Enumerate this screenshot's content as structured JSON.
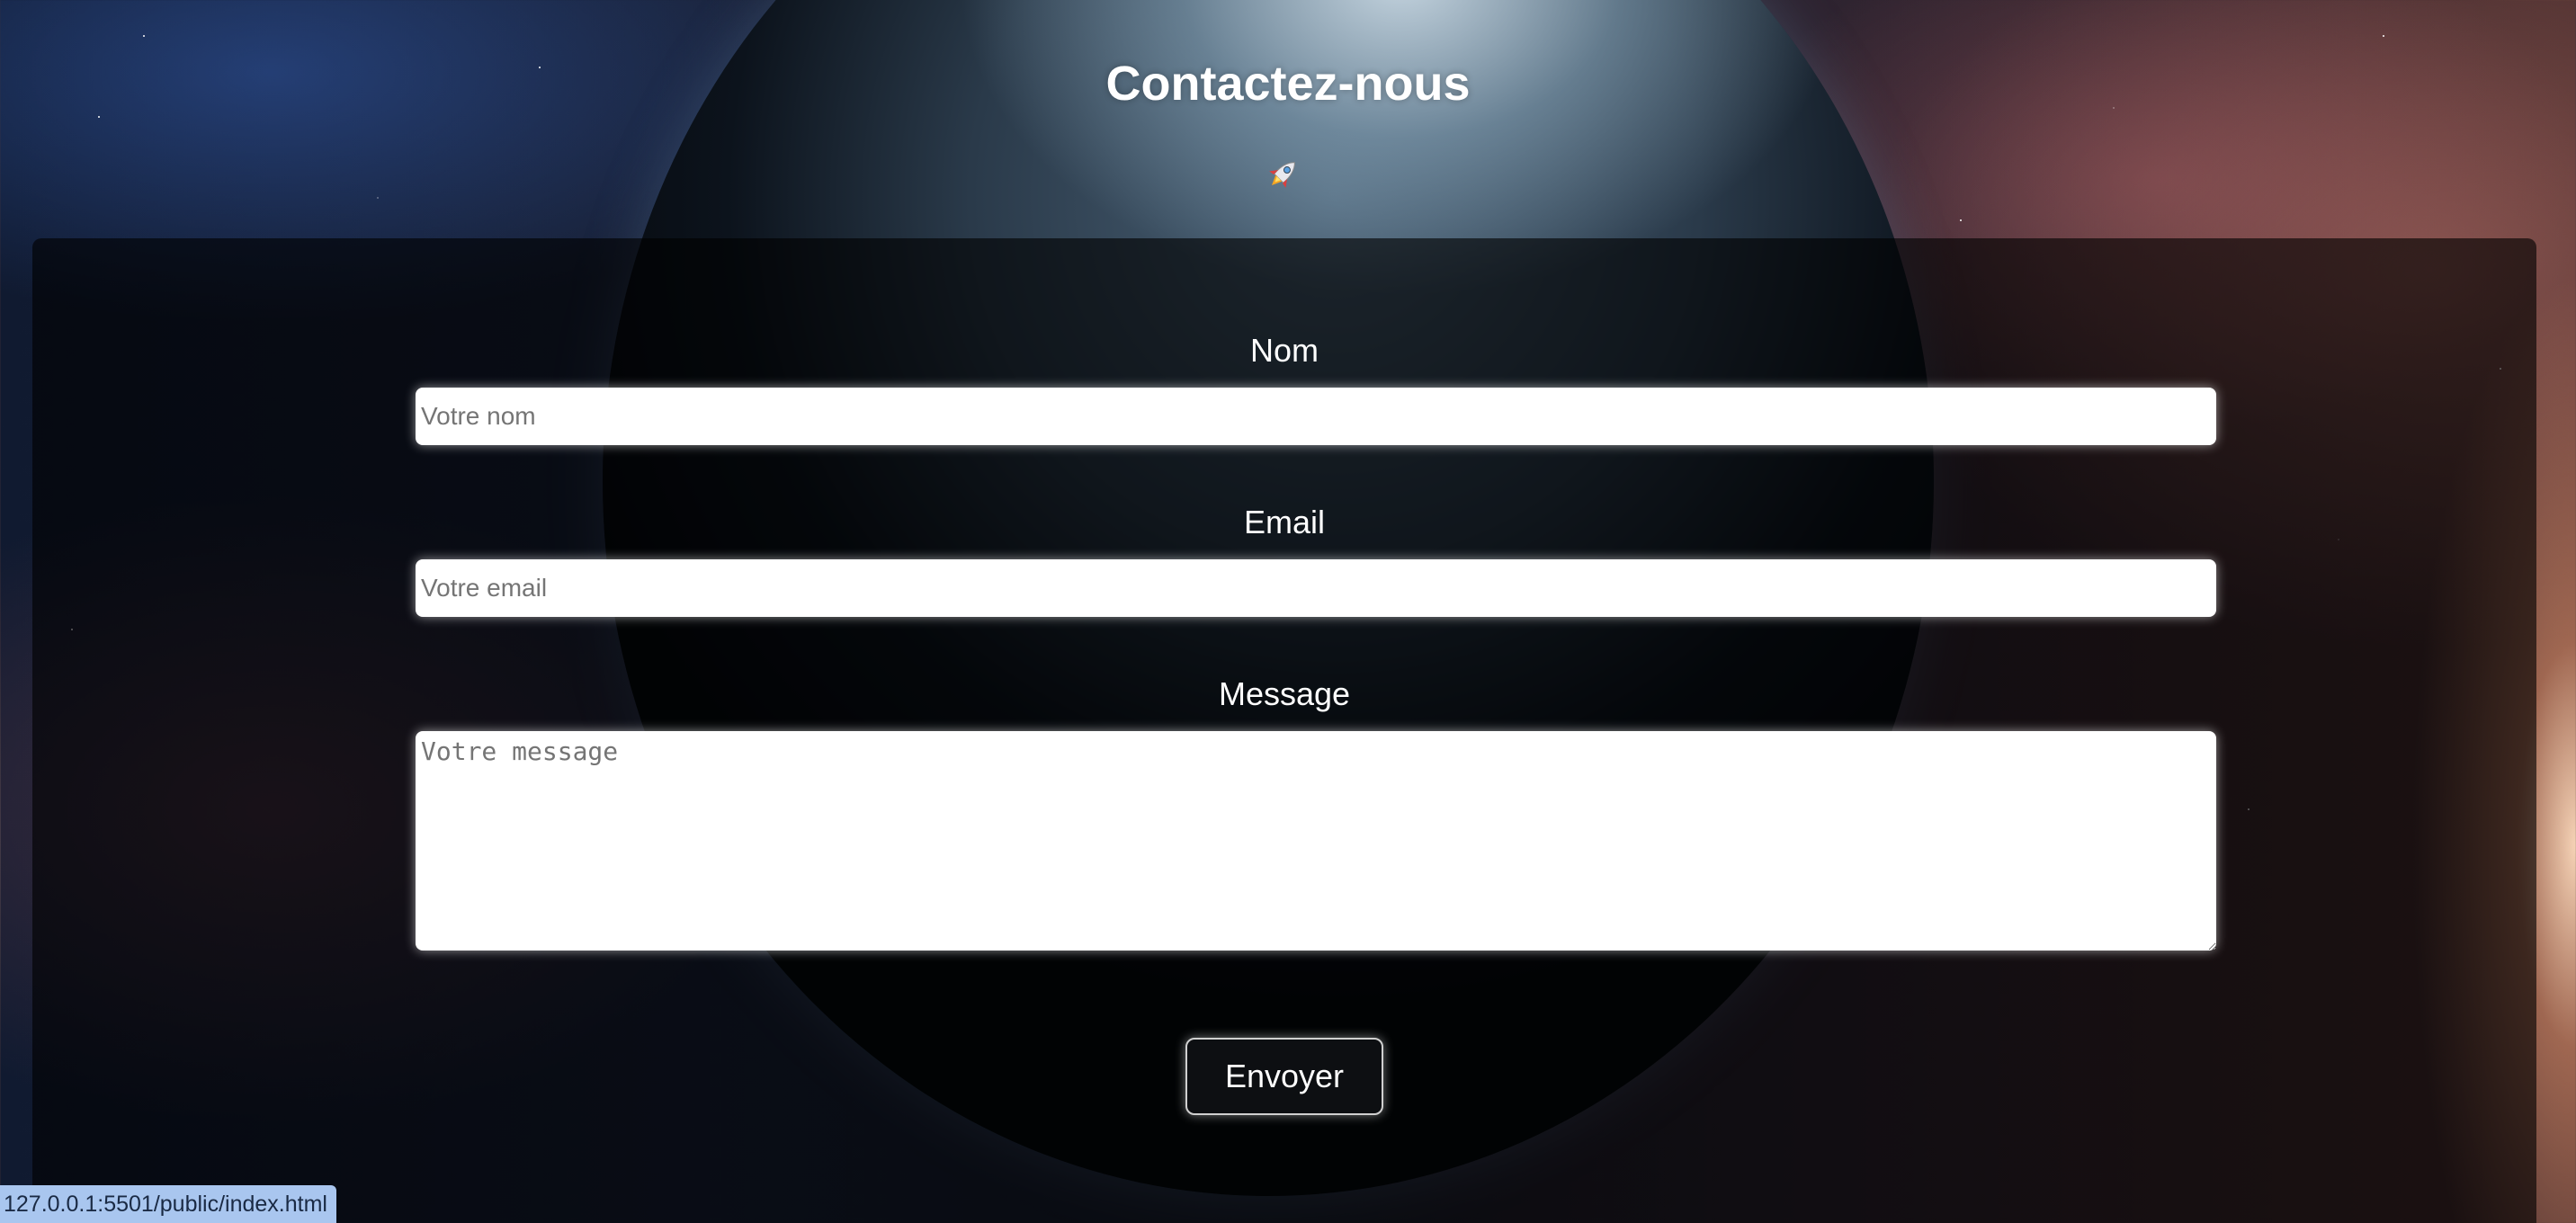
{
  "page": {
    "title": "Contactez-nous",
    "icon": "rocket-icon"
  },
  "form": {
    "name": {
      "label": "Nom",
      "placeholder": "Votre nom",
      "value": ""
    },
    "email": {
      "label": "Email",
      "placeholder": "Votre email",
      "value": ""
    },
    "message": {
      "label": "Message",
      "placeholder": "Votre message",
      "value": ""
    },
    "submit_label": "Envoyer"
  },
  "status_bar": {
    "url": "127.0.0.1:5501/public/index.html"
  },
  "colors": {
    "panel_background": "rgba(0,0,0,0.62)",
    "button_background": "#0d0f12",
    "status_bar_background": "#a9c6ef"
  }
}
